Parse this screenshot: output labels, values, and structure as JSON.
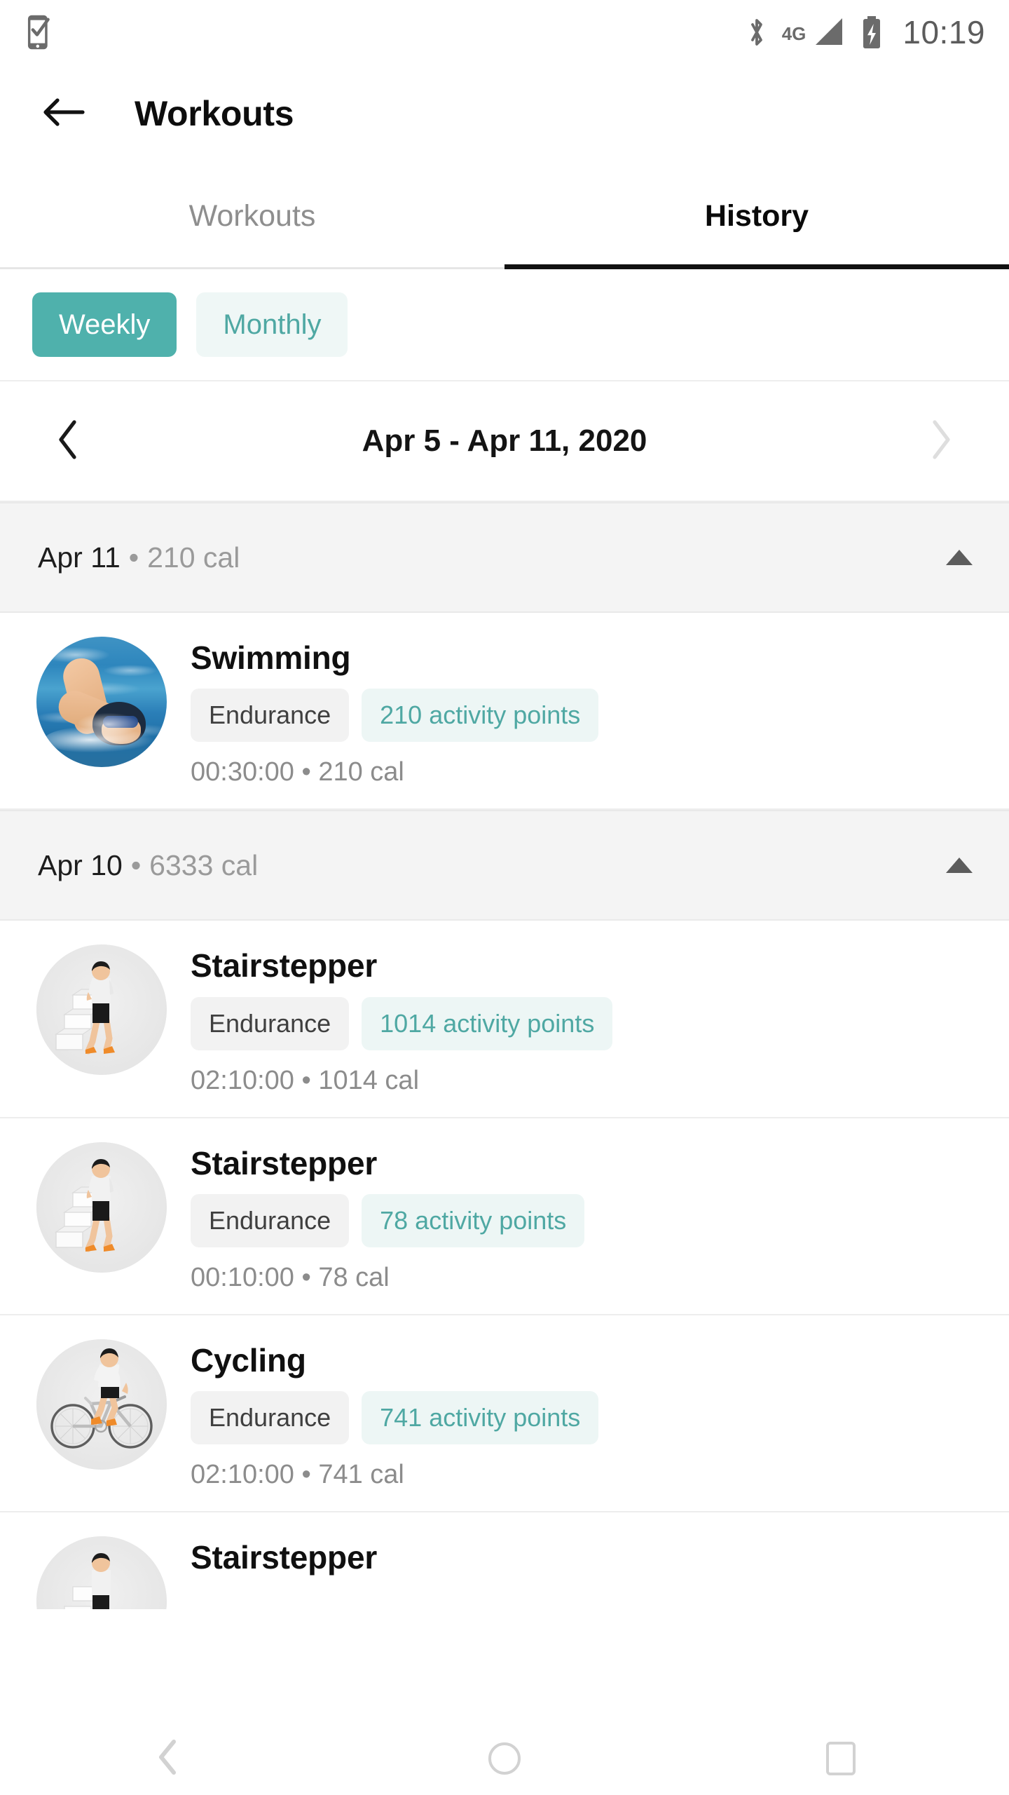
{
  "status_bar": {
    "left_icon": "phone-check-icon",
    "bluetooth_icon": "bluetooth-icon",
    "network_label": "4G",
    "signal_icon": "signal-bars-icon",
    "battery_icon": "battery-charging-icon",
    "time": "10:19"
  },
  "app_bar": {
    "back_icon": "back-arrow-icon",
    "title": "Workouts"
  },
  "tabs": [
    {
      "label": "Workouts",
      "active": false
    },
    {
      "label": "History",
      "active": true
    }
  ],
  "period_toggle": {
    "options": [
      {
        "label": "Weekly",
        "selected": true
      },
      {
        "label": "Monthly",
        "selected": false
      }
    ],
    "selected_color": "#4fb1ac",
    "unselected_bg": "#eff7f6",
    "unselected_text": "#4fa8a3"
  },
  "date_nav": {
    "prev_icon": "chevron-left-icon",
    "next_icon": "chevron-right-icon",
    "range_label": "Apr 5 - Apr 11, 2020",
    "prev_enabled": true,
    "next_enabled": false
  },
  "day_groups": [
    {
      "date": "Apr 11",
      "separator": "•",
      "calories": "210 cal",
      "collapse_icon": "triangle-up-icon",
      "expanded": true,
      "workouts": [
        {
          "thumb": "swimming-photo",
          "title": "Swimming",
          "type_chip": "Endurance",
          "points_chip": "210 activity points",
          "meta": "00:30:00 • 210 cal"
        }
      ]
    },
    {
      "date": "Apr 10",
      "separator": "•",
      "calories": "6333 cal",
      "collapse_icon": "triangle-up-icon",
      "expanded": true,
      "workouts": [
        {
          "thumb": "stairstepper-illustration",
          "title": "Stairstepper",
          "type_chip": "Endurance",
          "points_chip": "1014 activity points",
          "meta": "02:10:00 • 1014 cal"
        },
        {
          "thumb": "stairstepper-illustration",
          "title": "Stairstepper",
          "type_chip": "Endurance",
          "points_chip": "78 activity points",
          "meta": "00:10:00 • 78 cal"
        },
        {
          "thumb": "cycling-illustration",
          "title": "Cycling",
          "type_chip": "Endurance",
          "points_chip": "741 activity points",
          "meta": "02:10:00 • 741 cal"
        },
        {
          "thumb": "stairstepper-illustration",
          "title": "Stairstepper",
          "type_chip": "",
          "points_chip": "",
          "meta": ""
        }
      ]
    }
  ],
  "system_nav": {
    "back_icon": "nav-back-icon",
    "home_icon": "nav-home-icon",
    "recents_icon": "nav-recents-icon"
  },
  "colors": {
    "accent_teal": "#4fb1ac",
    "accent_teal_text": "#4fa8a3",
    "chip_mint_bg": "#edf6f5",
    "chip_gray_bg": "#f2f2f2",
    "group_header_bg": "#f4f4f4",
    "muted_text": "#8c8c8c"
  }
}
